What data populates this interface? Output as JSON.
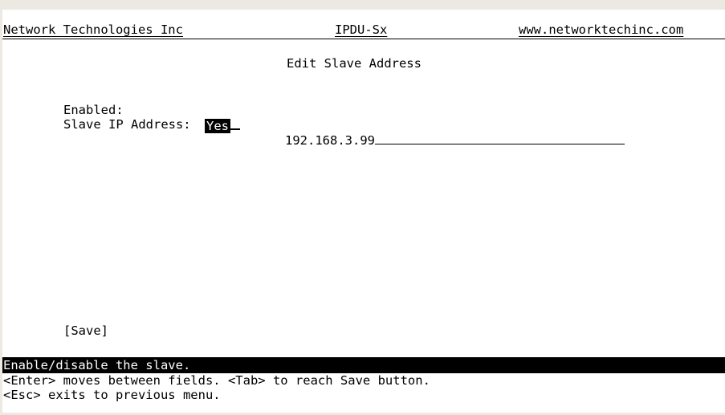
{
  "header": {
    "company": "Network Technologies Inc",
    "product": "IPDU-Sx",
    "url": "www.networktechinc.com"
  },
  "screen_title": "Edit Slave Address",
  "form": {
    "enabled_label": "Enabled:",
    "enabled_value": "Yes",
    "slave_ip_label": "Slave IP Address:",
    "slave_ip_value": "192.168.3.99"
  },
  "save_button_label": "[Save]",
  "status_help": "Enable/disable the slave.",
  "help_lines": [
    "<Enter> moves between fields. <Tab> to reach Save button.",
    "<Esc> exits to previous menu."
  ]
}
